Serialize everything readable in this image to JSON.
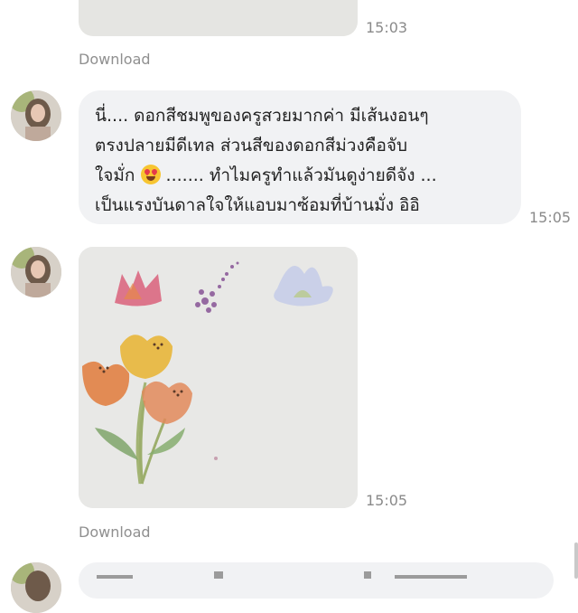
{
  "messages": [
    {
      "type": "image",
      "time": "15:03",
      "download_label": "Download"
    },
    {
      "type": "text",
      "lines": [
        "นี่.... ดอกสีชมพูของครูสวยมากค่า มีเส้นงอนๆ",
        "ตรงปลายมีดีเทล ส่วนสีของดอกสีม่วงคือจับ",
        "ใจมั่ก",
        "....... ทำไมครูทำแล้วมันดูง่ายดีจัง ...",
        "เป็นแรงบันดาลใจให้แอบมาซ้อมที่บ้านมั่ง อิอิ"
      ],
      "emoji": "smiling-face-with-heart-eyes",
      "time": "15:05"
    },
    {
      "type": "image",
      "time": "15:05",
      "download_label": "Download"
    }
  ],
  "colors": {
    "bubble": "#f1f2f4",
    "time": "#8a8a8a",
    "download": "#8f8f8f"
  }
}
